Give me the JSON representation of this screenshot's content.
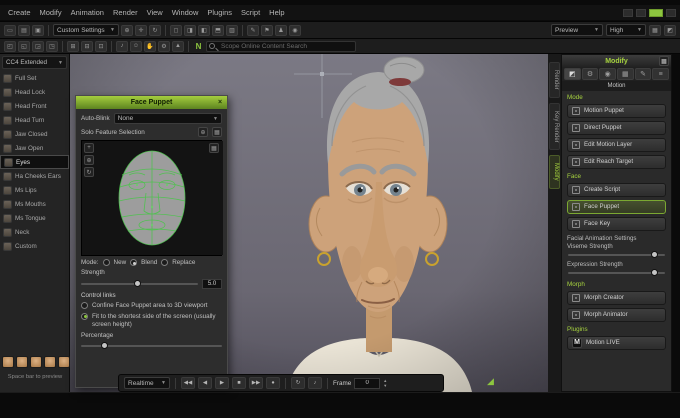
{
  "icons": {
    "dropdown": "▼",
    "close": "×",
    "checker": "▦",
    "grid": "▦",
    "target": "⊕",
    "reset": "↻",
    "plus": "+",
    "loop": "↻",
    "audio": "♪",
    "record": "●",
    "play": "▶",
    "prev": "◀",
    "first": "◀◀",
    "next": "▶▶",
    "stop": "■",
    "up": "▲",
    "down": "▼",
    "expand": "◢",
    "tab1": "◩",
    "tab2": "⚙",
    "tab3": "◉",
    "tab4": "▦",
    "tab5": "✎",
    "tab6": "≡"
  },
  "menubar": {
    "items": [
      "Create",
      "Modify",
      "Animation",
      "Render",
      "View",
      "Window",
      "Plugins",
      "Script",
      "Help"
    ]
  },
  "toolbar": {
    "custom_settings": "Custom Settings",
    "preview": "Preview",
    "quality": "High",
    "logo": "N",
    "search_placeholder": "Scope Online Content Search"
  },
  "left_sidebar": {
    "header": "CC4 Extended",
    "items": [
      "Full Set",
      "Head Lock",
      "Head Front",
      "Head Turn",
      "Jaw Closed",
      "Jaw Open",
      "Eyes",
      "Ha Cheeks Ears",
      "Ms Lips",
      "Ms Mouths",
      "Ms Tongue",
      "Neck",
      "Custom"
    ],
    "footer": "Space bar to preview"
  },
  "face_panel": {
    "title": "Face Puppet",
    "auto_blink_label": "Auto-Blink",
    "auto_blink_value": "None",
    "solo_label": "Solo Feature Selection",
    "mode_label": "Mode:",
    "mode_new": "New",
    "mode_blend": "Blend",
    "mode_replace": "Replace",
    "strength_label": "Strength",
    "strength_value": "5.0",
    "control_links_label": "Control links",
    "option_confine": "Confine Face Puppet area to 3D viewport",
    "option_fit": "Fit to the shortest side of the screen (usually screen height)",
    "percentage_label": "Percentage"
  },
  "right_tabs": [
    "Render",
    "Key Render",
    "Modify"
  ],
  "right_panel": {
    "title": "Modify",
    "subbar": "Motion",
    "section_mode": "Mode",
    "section_face": "Face",
    "section_morph": "Morph",
    "section_plugins": "Plugins",
    "mode_buttons": [
      "Motion Puppet",
      "Direct Puppet",
      "Edit Motion Layer",
      "Edit Reach Target"
    ],
    "face_buttons": [
      "Create Script",
      "Face Puppet",
      "Face Key"
    ],
    "facial_settings_label": "Facial Animation Settings",
    "viseme_label": "Viseme Strength",
    "expression_label": "Expression Strength",
    "morph_buttons": [
      "Morph Creator",
      "Morph Animator"
    ],
    "plugin_button": "Motion LIVE",
    "motion_live_logo": "M"
  },
  "bottom_bar": {
    "realtime": "Realtime",
    "frame_label": "Frame",
    "frame_value": "0"
  }
}
